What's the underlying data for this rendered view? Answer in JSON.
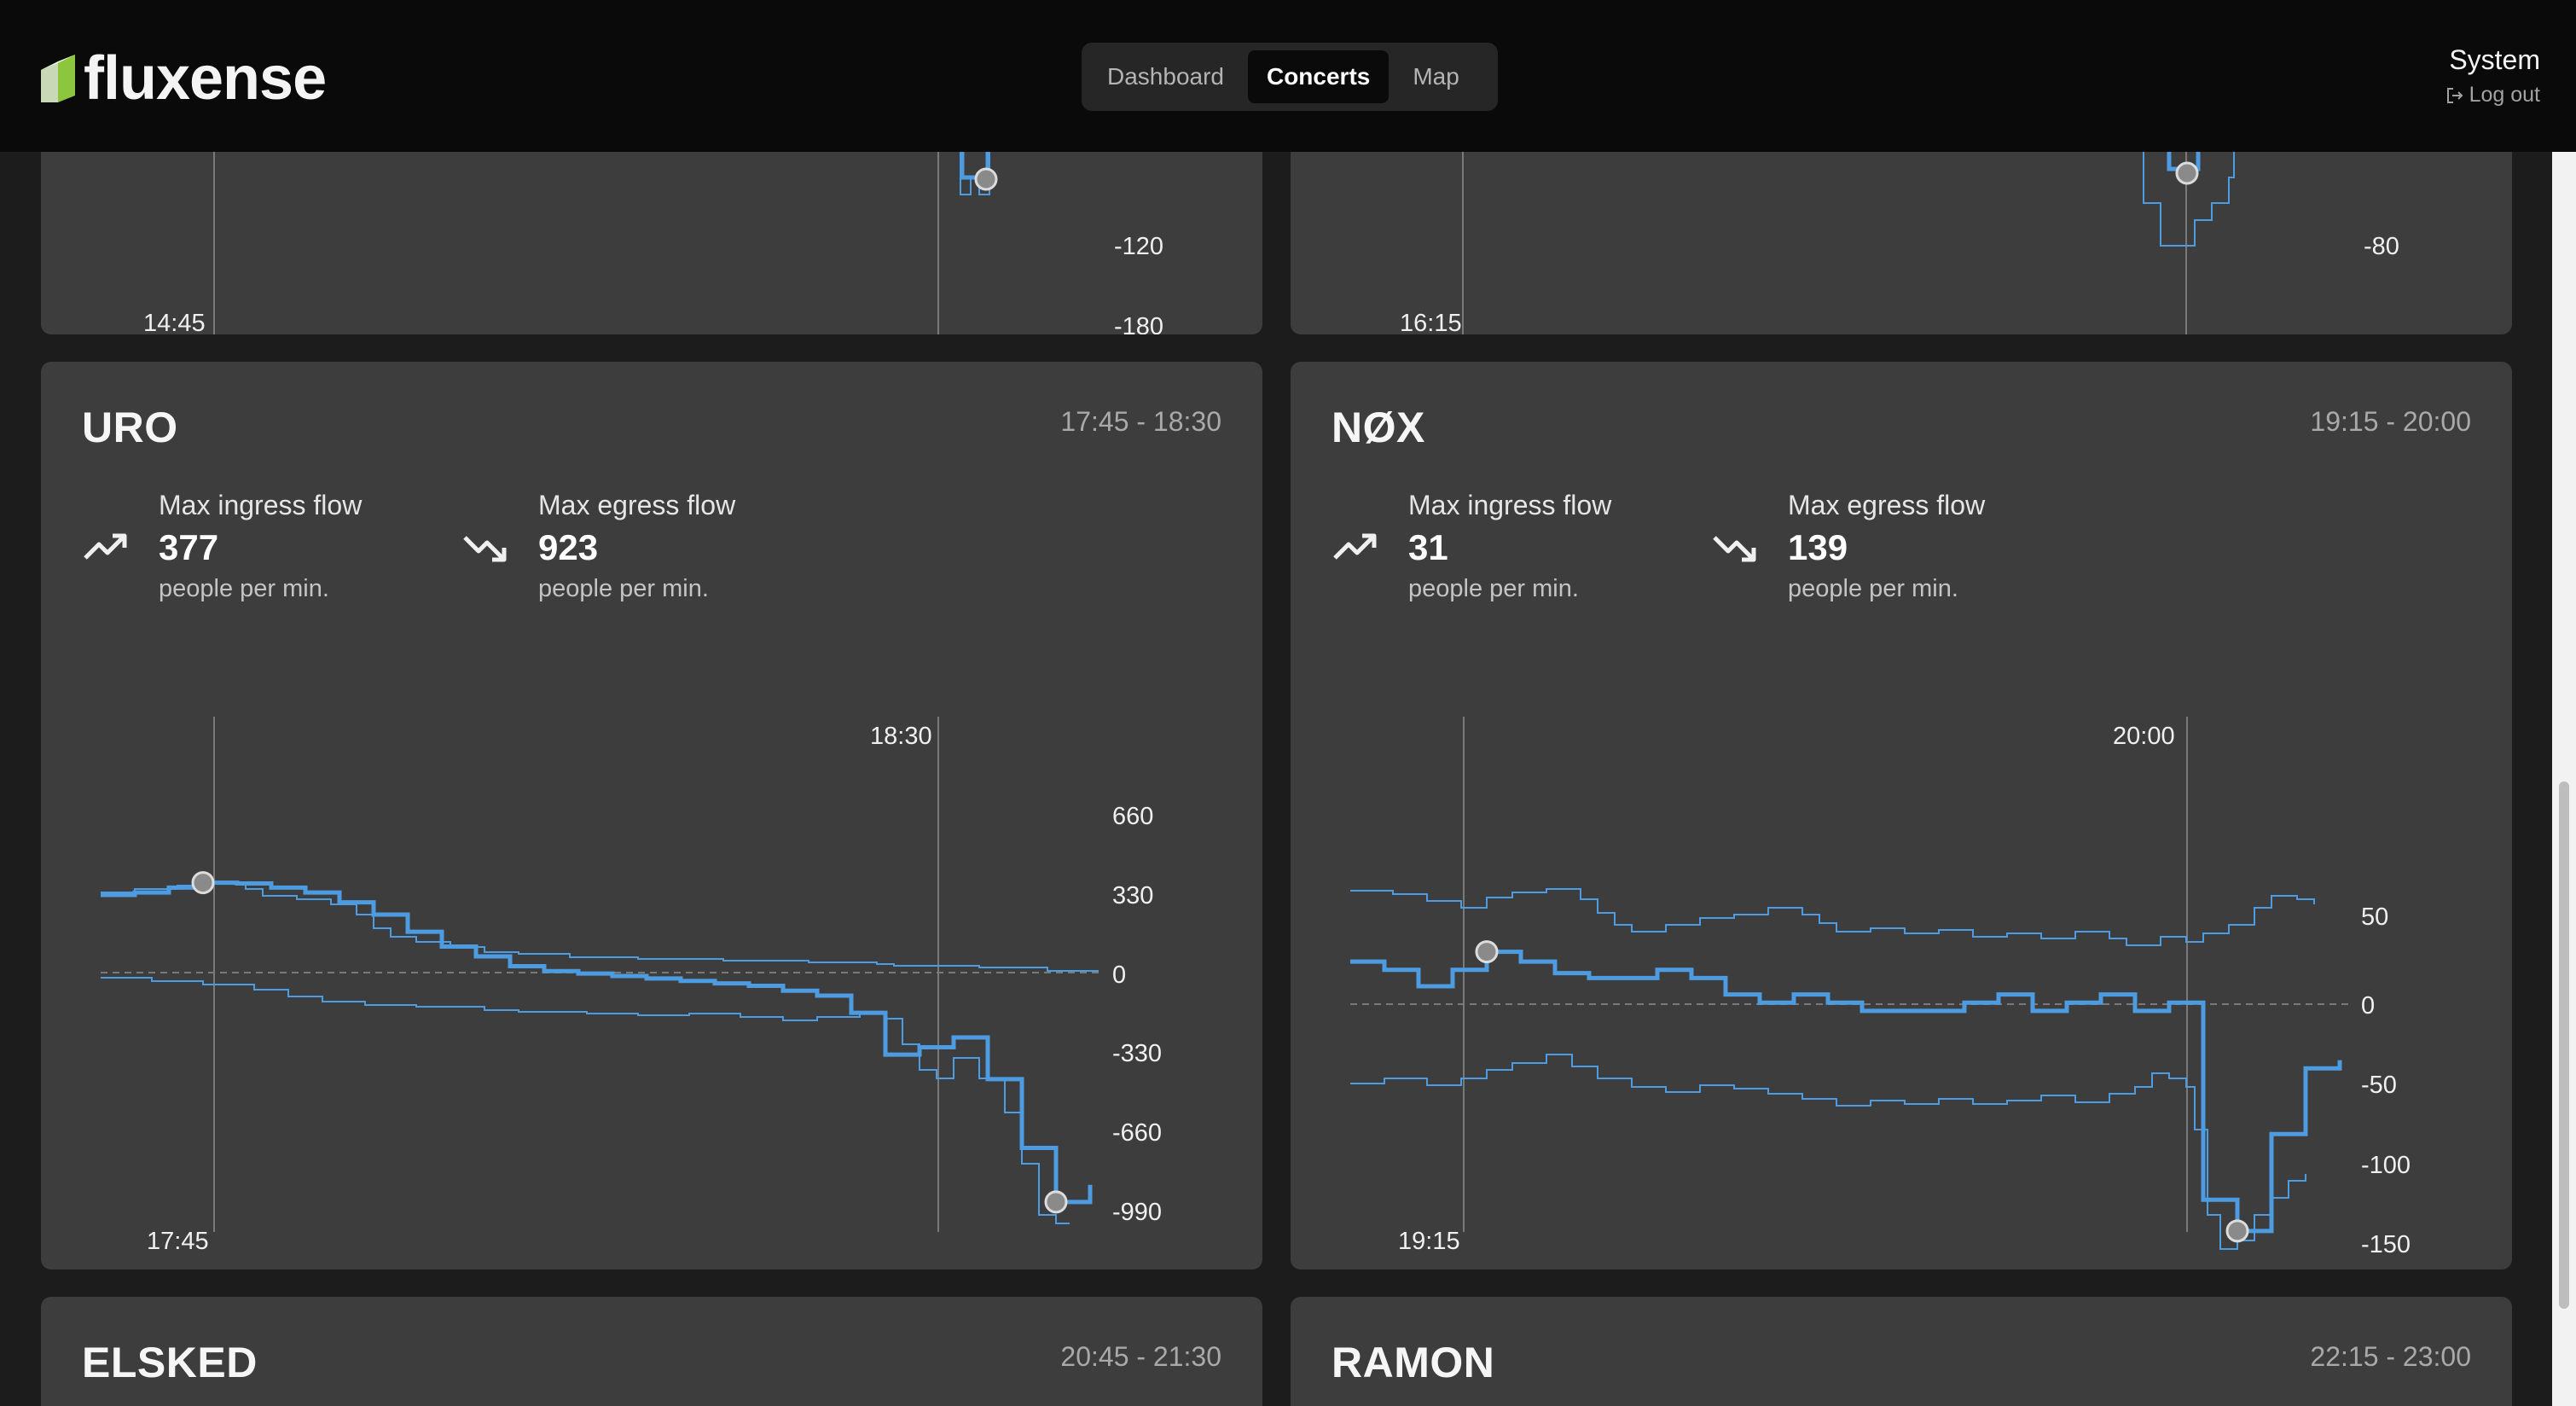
{
  "header": {
    "logo_text": "fluxense",
    "nav": [
      {
        "label": "Dashboard",
        "active": false
      },
      {
        "label": "Concerts",
        "active": true
      },
      {
        "label": "Map",
        "active": false
      }
    ],
    "user_name": "System",
    "logout_label": "Log out"
  },
  "top_cards": [
    {
      "x_label": "14:45",
      "y_ticks": [
        "-120",
        "-180"
      ]
    },
    {
      "x_label": "16:15",
      "y_ticks": [
        "-80"
      ]
    }
  ],
  "concerts": [
    {
      "name": "URO",
      "time_range": "17:45 - 18:30",
      "ingress_label": "Max ingress flow",
      "ingress_value": "377",
      "egress_label": "Max egress flow",
      "egress_value": "923",
      "unit": "people per min.",
      "start_label": "17:45",
      "end_label": "18:30",
      "y_ticks": [
        "660",
        "330",
        "0",
        "-330",
        "-660",
        "-990"
      ]
    },
    {
      "name": "NØX",
      "time_range": "19:15 - 20:00",
      "ingress_label": "Max ingress flow",
      "ingress_value": "31",
      "egress_label": "Max egress flow",
      "egress_value": "139",
      "unit": "people per min.",
      "start_label": "19:15",
      "end_label": "20:00",
      "y_ticks": [
        "50",
        "0",
        "-50",
        "-100",
        "-150"
      ]
    },
    {
      "name": "ELSKED",
      "time_range": "20:45 - 21:30"
    },
    {
      "name": "RAMON",
      "time_range": "22:15 - 23:00"
    }
  ],
  "chart_data": [
    {
      "type": "line",
      "title": "URO",
      "ylim": [
        -990,
        660
      ],
      "y_ticks": [
        660,
        330,
        0,
        -330,
        -660,
        -990
      ],
      "x_markers": [
        "17:45",
        "18:30"
      ],
      "series": [
        {
          "values": [
            330,
            340,
            360,
            380,
            377,
            360,
            340,
            300,
            250,
            180,
            120,
            80,
            40,
            20,
            10,
            0,
            -10,
            -20,
            -30,
            -40,
            -60,
            -80,
            -150,
            -320,
            -290,
            -250,
            -420,
            -700,
            -920,
            -850
          ]
        }
      ]
    },
    {
      "type": "line",
      "title": "NØX",
      "ylim": [
        -170,
        70
      ],
      "y_ticks": [
        50,
        0,
        -50,
        -100,
        -150
      ],
      "x_markers": [
        "19:15",
        "20:00"
      ],
      "series": [
        {
          "values": [
            25,
            20,
            10,
            20,
            31,
            25,
            18,
            15,
            15,
            20,
            15,
            5,
            0,
            5,
            0,
            -5,
            -5,
            -5,
            0,
            5,
            -5,
            0,
            5,
            -5,
            0,
            -120,
            -139,
            -80,
            -40,
            -35
          ]
        }
      ]
    }
  ],
  "colors": {
    "accent": "#4d9be0",
    "card": "#3d3d3d",
    "background": "#1c1c1c"
  }
}
